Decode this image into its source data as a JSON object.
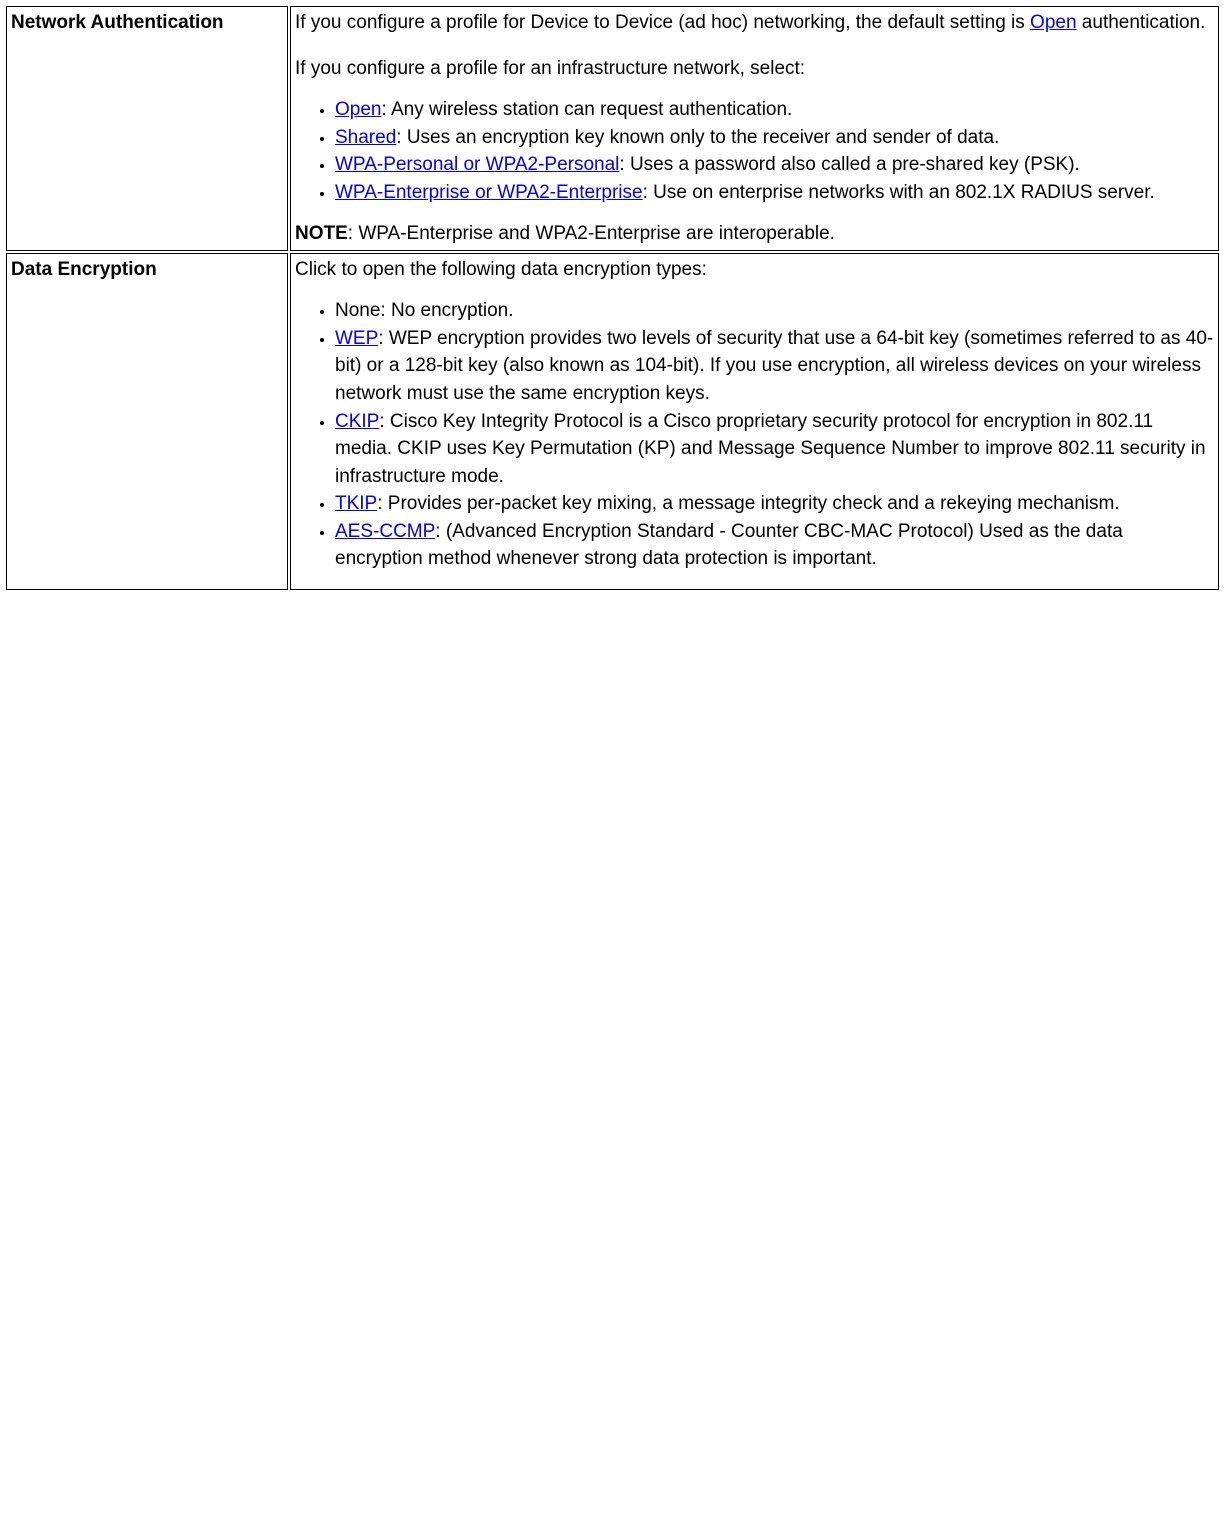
{
  "rows": {
    "auth": {
      "label": "Network Authentication",
      "p1a": "If you configure a profile for Device to Device (ad hoc) networking, the default setting is ",
      "p1_link": "Open",
      "p1b": " authentication.",
      "p2": "If you configure a profile for an infrastructure network, select:",
      "items": {
        "open": {
          "link": "Open",
          "text": ": Any wireless station can request authentication."
        },
        "shared": {
          "link": "Shared",
          "text": ": Uses an encryption key known only to the receiver and sender of data."
        },
        "wpa_personal": {
          "link": "WPA-Personal or WPA2-Personal",
          "text": ": Uses a password also called a pre-shared key (PSK)."
        },
        "wpa_enterprise": {
          "link": "WPA-Enterprise or WPA2-Enterprise",
          "text": ": Use on enterprise networks with an 802.1X RADIUS server."
        }
      },
      "note_label": "NOTE",
      "note_text": ": WPA-Enterprise and WPA2-Enterprise are interoperable."
    },
    "enc": {
      "label": "Data Encryption",
      "p1": "Click to open the following data encryption types:",
      "items": {
        "none": {
          "prefix": "None",
          "text": ": No encryption."
        },
        "wep": {
          "link": "WEP",
          "text": ": WEP encryption provides two levels of security that use a 64-bit key (sometimes referred to as 40-bit) or a 128-bit key (also known as 104-bit). If you use encryption, all wireless devices on your wireless network must use the same encryption keys."
        },
        "ckip": {
          "link": "CKIP",
          "text": ": Cisco Key Integrity Protocol is a Cisco proprietary security protocol for encryption in 802.11 media. CKIP uses Key Permutation (KP) and Message Sequence Number to improve 802.11 security in infrastructure mode."
        },
        "tkip": {
          "link": "TKIP",
          "text": ": Provides per-packet key mixing, a message integrity check and a rekeying mechanism."
        },
        "aes": {
          "link": "AES-CCMP",
          "text": ": (Advanced Encryption Standard - Counter CBC-MAC Protocol) Used as the data encryption method whenever strong data protection is important."
        }
      }
    }
  }
}
